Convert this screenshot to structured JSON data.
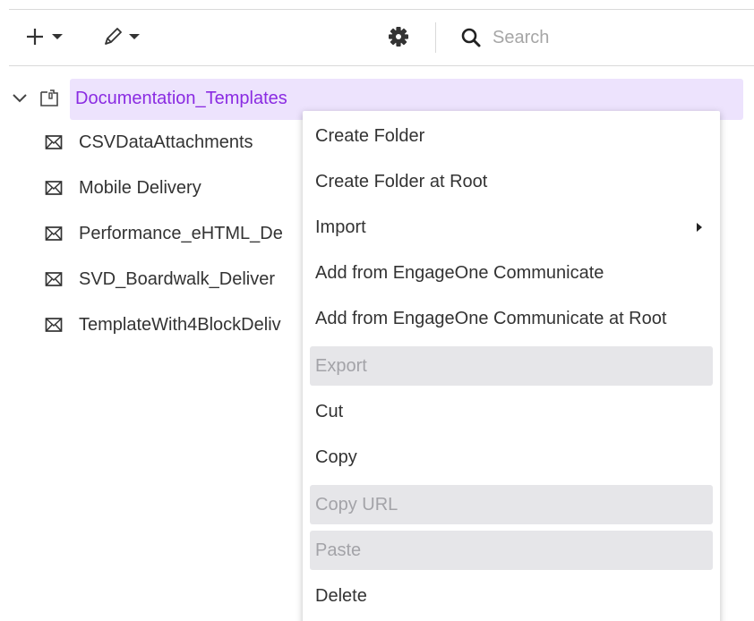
{
  "toolbar": {
    "add_icon": "plus-dropdown-icon",
    "edit_icon": "pencil-dropdown-icon",
    "settings_icon": "gear-icon",
    "search_icon": "search-icon",
    "search_placeholder": "Search"
  },
  "tree": {
    "root": {
      "label": "Documentation_Templates",
      "icon": "folder-icon",
      "expanded": true
    },
    "children": [
      {
        "label": "CSVDataAttachments",
        "icon": "mail-icon"
      },
      {
        "label": "Mobile Delivery",
        "icon": "mail-icon"
      },
      {
        "label": "Performance_eHTML_De",
        "icon": "mail-icon"
      },
      {
        "label": "SVD_Boardwalk_Deliver",
        "icon": "mail-icon"
      },
      {
        "label": "TemplateWith4BlockDeliv",
        "icon": "mail-icon"
      }
    ]
  },
  "context_menu": {
    "items": [
      {
        "label": "Create Folder",
        "disabled": false
      },
      {
        "label": "Create Folder at Root",
        "disabled": false
      },
      {
        "label": "Import",
        "disabled": false,
        "submenu": true
      },
      {
        "label": "Add from EngageOne Communicate",
        "disabled": false
      },
      {
        "label": "Add from EngageOne Communicate at Root",
        "disabled": false
      },
      {
        "label": "Export",
        "disabled": true
      },
      {
        "label": "Cut",
        "disabled": false
      },
      {
        "label": "Copy",
        "disabled": false
      },
      {
        "label": "Copy URL",
        "disabled": true
      },
      {
        "label": "Paste",
        "disabled": true
      },
      {
        "label": "Delete",
        "disabled": false
      }
    ]
  },
  "colors": {
    "accent": "#8a2be2",
    "selection_bg": "#ede3fd",
    "disabled_bg": "#e6e6e9",
    "disabled_text": "#a3a3a8"
  }
}
